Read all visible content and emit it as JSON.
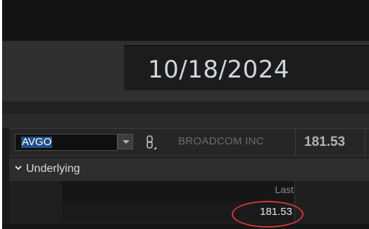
{
  "header": {
    "date": "10/18/2024"
  },
  "symbol_bar": {
    "symbol": "AVGO",
    "company_name": "BROADCOM INC",
    "last_price": "181.53"
  },
  "section": {
    "label": "Underlying"
  },
  "table": {
    "columns": [
      "Last"
    ],
    "rows": [
      {
        "last": "181.53"
      }
    ]
  },
  "annotation": {
    "highlight_color": "#d0383a"
  },
  "icons": {
    "dropdown": "chevron-down-icon",
    "link": "link-icon",
    "collapse": "chevron-down-icon"
  }
}
